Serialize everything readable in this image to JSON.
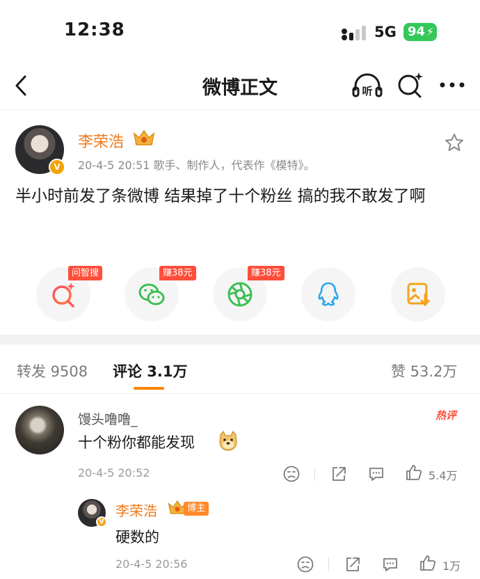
{
  "status_bar": {
    "time": "12:38",
    "network": "5G",
    "battery": "94"
  },
  "nav": {
    "title": "微博正文",
    "listen_icon": "听"
  },
  "post": {
    "author": "李荣浩",
    "meta": "20-4-5 20:51  歌手、制作人，代表作《模特》。",
    "text": "半小时前发了条微博 结果掉了十个粉丝 搞的我不敢发了啊",
    "share_tags": [
      "问智搜",
      "赚38元",
      "赚38元"
    ],
    "share_icons": [
      "zhisou-search-icon",
      "wechat-icon",
      "moments-icon",
      "qq-icon",
      "save-image-icon"
    ],
    "verified_mark": "V"
  },
  "tabs": {
    "repost": "转发 9508",
    "comments": "评论 3.1万",
    "likes": "赞 53.2万"
  },
  "colors": {
    "accent": "#ff8200",
    "author": "#f07a1c",
    "tag_red": "#ff4e3b"
  },
  "comment": {
    "name": "馒头噜噜_",
    "hot_label": "热评",
    "text": "十个粉你都能发现",
    "time": "20-4-5 20:52",
    "likes": "5.4万"
  },
  "reply": {
    "name": "李荣浩",
    "badge": "博主",
    "text": "硬数的",
    "time": "20-4-5 20:56",
    "likes": "1万"
  }
}
